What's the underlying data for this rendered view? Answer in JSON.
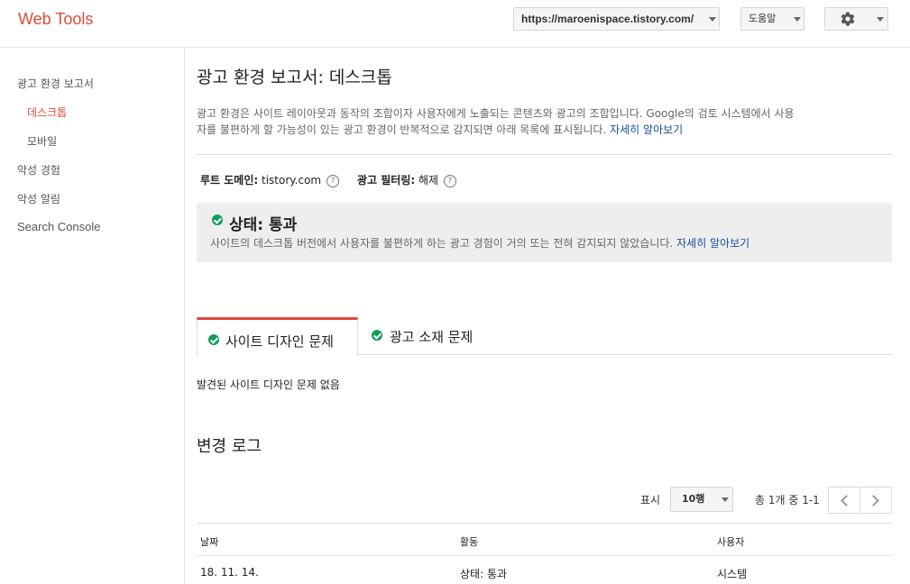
{
  "header": {
    "logo": "Web Tools",
    "site_url": "https://maroenispace.tistory.com/",
    "help_label": "도움말",
    "settings_icon": "gear-icon"
  },
  "sidebar": {
    "items": [
      {
        "label": "광고 환경 보고서"
      },
      {
        "label": "데스크톱",
        "active": true
      },
      {
        "label": "모바일"
      },
      {
        "label": "악성 경험"
      },
      {
        "label": "악성 알림"
      },
      {
        "label": "Search Console"
      }
    ]
  },
  "main": {
    "title": "광고 환경 보고서: 데스크톱",
    "description_line1": "광고 환경은 사이트 레이아웃과 동작의 조합이자 사용자에게 노출되는 콘텐츠와 광고의 조합입니다. Google의 검토 시스템에서 사용",
    "description_line2": "자를 불편하게 할 가능성이 있는 광고 환경이 반복적으로 감지되면 아래 목록에 표시됩니다.",
    "learn_more": "자세히 알아보기",
    "root_domain_label": "루트 도메인:",
    "root_domain_value": "tistory.com",
    "ad_filtering_label": "광고 필터링:",
    "ad_filtering_value": "해제",
    "status": {
      "title": "상태: 통과",
      "description": "사이트의 데스크톱 버전에서 사용자를 불편하게 하는 광고 경험이 거의 또는 전혀 감지되지 않았습니다.",
      "learn_more": "자세히 알아보기",
      "color": "#0f9d58"
    },
    "tabs": [
      {
        "label": "사이트 디자인 문제",
        "active": true
      },
      {
        "label": "광고 소재 문제",
        "active": false
      }
    ],
    "no_issues": "발견된 사이트 디자인 문제 없음",
    "changelog": {
      "title": "변경 로그",
      "show_label": "표시",
      "rows_option": "10행",
      "range_text": "총 1개 중 1-1",
      "columns": [
        "날짜",
        "활동",
        "사용자"
      ],
      "rows": [
        [
          "18. 11. 14.",
          "상태: 통과",
          "시스템"
        ]
      ]
    }
  },
  "colors": {
    "accent": "#dd4b39",
    "link": "#1a4fa0",
    "pass": "#0f9d58"
  }
}
